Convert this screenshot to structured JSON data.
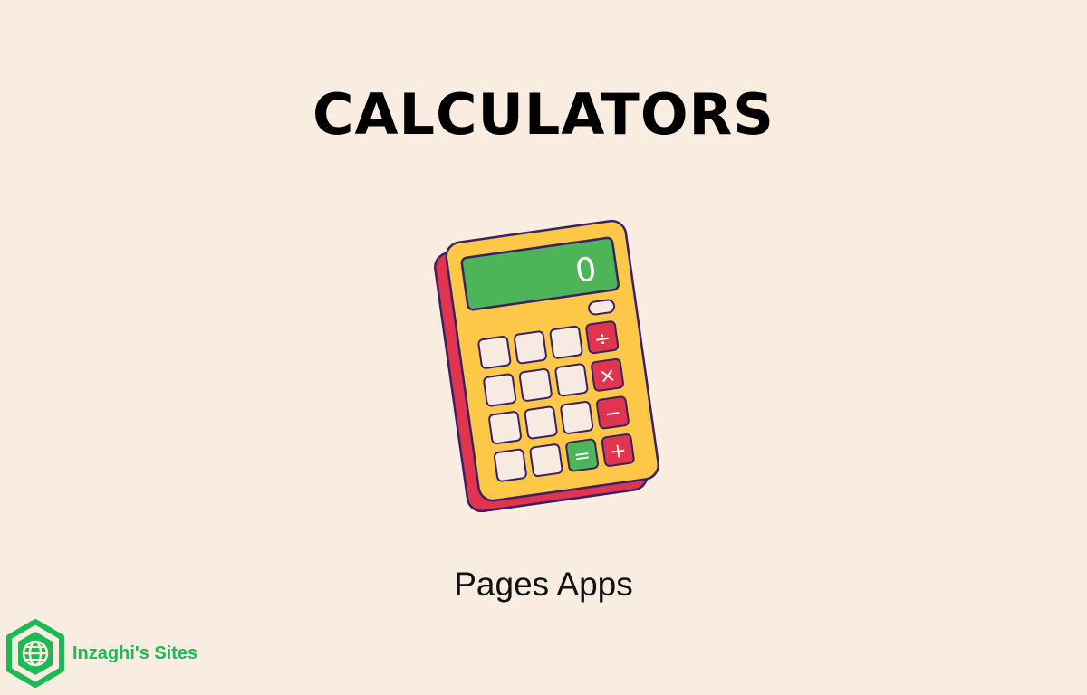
{
  "title": "CALCULATORS",
  "subtitle": "Pages Apps",
  "calculator": {
    "display_value": "0",
    "keys": {
      "divide": "÷",
      "multiply": "×",
      "minus": "−",
      "equals": "=",
      "plus": "+"
    }
  },
  "brand": {
    "name": "Inzaghi's Sites",
    "logo_icon": "globe-hexagon-icon"
  },
  "colors": {
    "background": "#f8ede0",
    "calculator_body": "#fdc847",
    "calculator_side": "#e0344f",
    "display": "#4db558",
    "operator_keys": "#e0344f",
    "equals_key": "#4db558",
    "brand_green": "#1db954"
  }
}
